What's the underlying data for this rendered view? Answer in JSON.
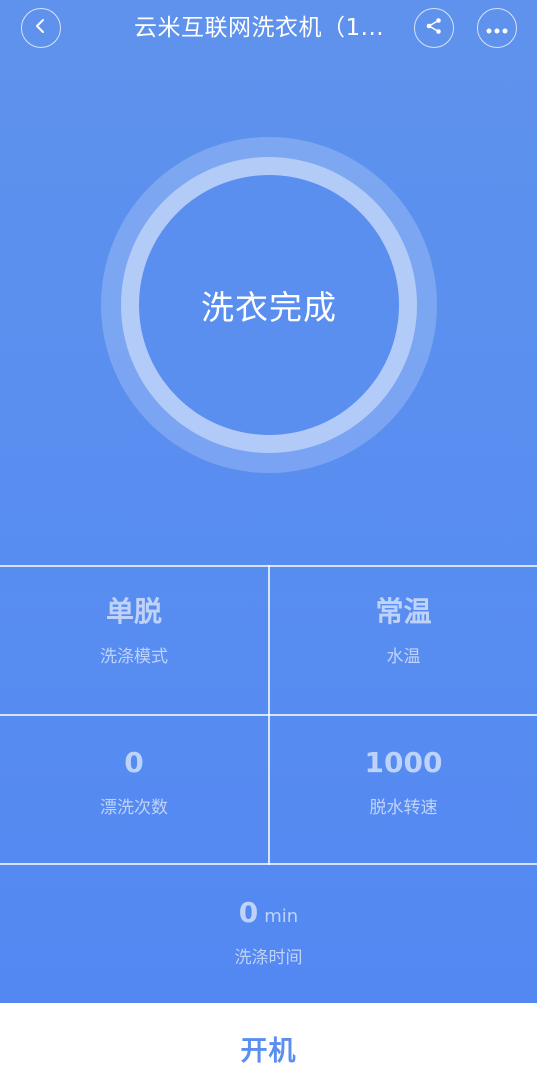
{
  "header": {
    "title": "云米互联网洗衣机（1...",
    "back_icon": "chevron-left-icon",
    "share_icon": "share-icon",
    "more_icon": "more-horizontal-icon"
  },
  "status": {
    "text": "洗衣完成"
  },
  "settings": {
    "wash_mode": {
      "value": "单脱",
      "label": "洗涤模式"
    },
    "water_temp": {
      "value": "常温",
      "label": "水温"
    },
    "rinse_count": {
      "value": "0",
      "label": "漂洗次数"
    },
    "spin_speed": {
      "value": "1000",
      "label": "脱水转速"
    },
    "wash_time": {
      "value": "0",
      "unit": "min",
      "label": "洗涤时间"
    }
  },
  "footer": {
    "power_label": "开机"
  },
  "colors": {
    "background": "#5a8ff0",
    "accent": "#5a8ff0",
    "text": "#ffffff"
  }
}
